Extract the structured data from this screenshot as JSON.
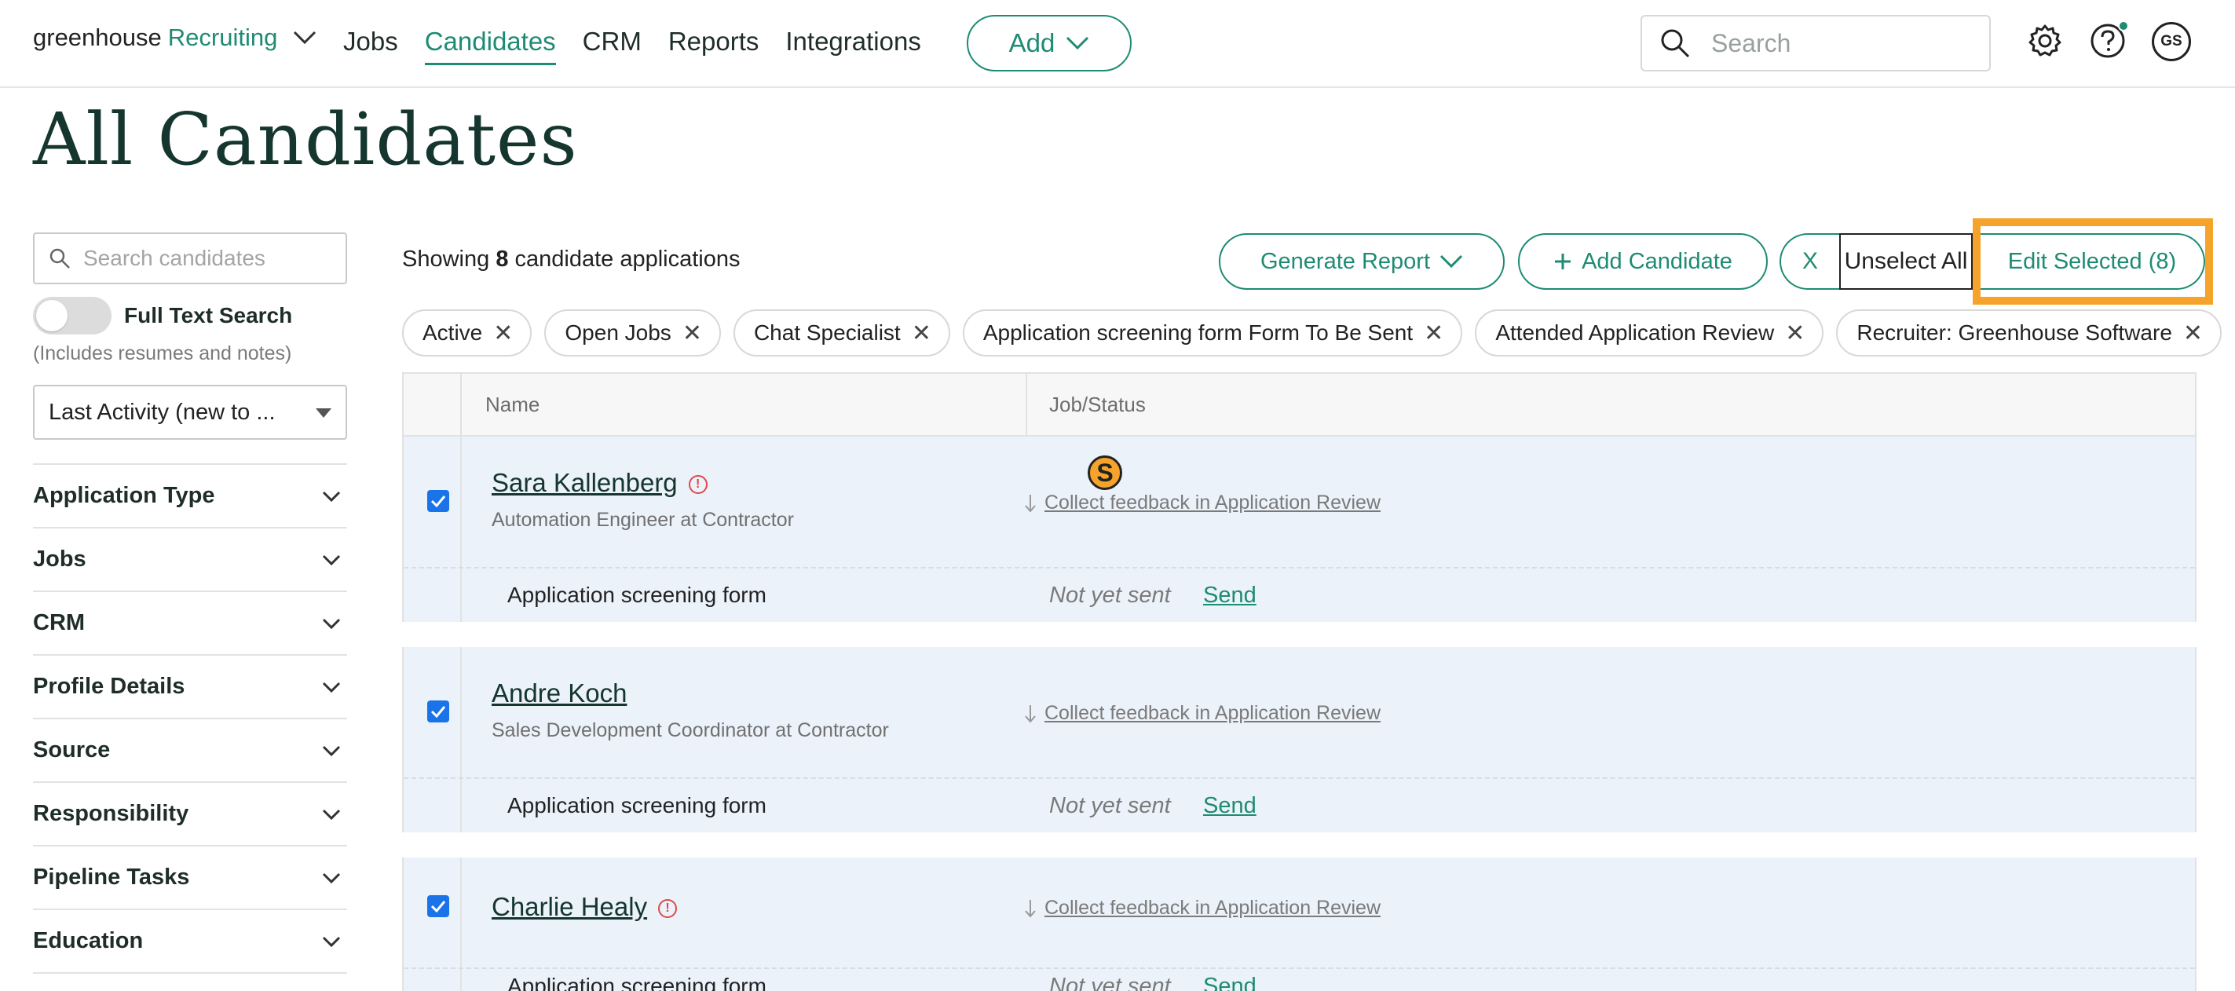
{
  "nav": {
    "logo_main": "greenhouse",
    "logo_accent": "Recruiting",
    "links": [
      "Jobs",
      "Candidates",
      "CRM",
      "Reports",
      "Integrations"
    ],
    "add_label": "Add",
    "search_placeholder": "Search",
    "avatar_initials": "GS"
  },
  "page": {
    "title": "All Candidates"
  },
  "sidebar": {
    "search_placeholder": "Search candidates",
    "full_text_label": "Full Text Search",
    "full_text_note": "(Includes resumes and notes)",
    "sort_value": "Last Activity (new to ...",
    "facets": [
      "Application Type",
      "Jobs",
      "CRM",
      "Profile Details",
      "Source",
      "Responsibility",
      "Pipeline Tasks",
      "Education"
    ]
  },
  "toolbar": {
    "showing_prefix": "Showing",
    "showing_count": "8",
    "showing_suffix": "candidate applications",
    "generate_report": "Generate Report",
    "add_candidate": "Add Candidate",
    "clear_x": "X",
    "unselect_all": "Unselect All",
    "edit_selected": "Edit Selected (8)"
  },
  "filters": [
    "Active",
    "Open Jobs",
    "Chat Specialist",
    "Application screening form Form To Be Sent",
    "Attended Application Review",
    "Recruiter: Greenhouse Software"
  ],
  "table": {
    "headers": {
      "name": "Name",
      "status": "Job/Status"
    },
    "rows": [
      {
        "name": "Sara Kallenberg",
        "subtitle": "Automation Engineer at Contractor",
        "status": "Collect feedback in Application Review",
        "form": "Application screening form",
        "form_status": "Not yet sent",
        "send": "Send"
      },
      {
        "name": "Andre Koch",
        "subtitle": "Sales Development Coordinator at Contractor",
        "status": "Collect feedback in Application Review",
        "form": "Application screening form",
        "form_status": "Not yet sent",
        "send": "Send"
      },
      {
        "name": "Charlie Healy",
        "subtitle": "",
        "status": "Collect feedback in Application Review",
        "form": "Application screening form",
        "form_status": "Not yet sent",
        "send": "Send"
      }
    ]
  },
  "cursor_marker": "S",
  "colors": {
    "brand": "#1e8b73",
    "highlight": "#f5a32a",
    "row_bg": "#ebf2fa",
    "checkbox": "#1a73e8"
  }
}
